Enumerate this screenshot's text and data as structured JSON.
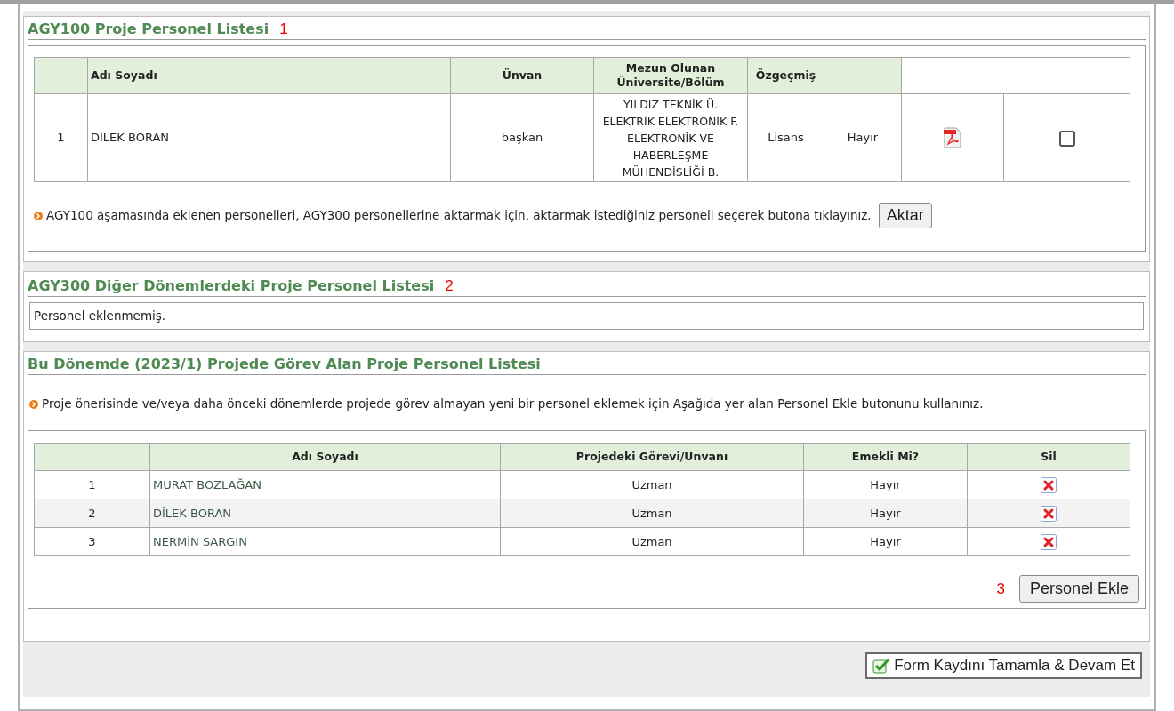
{
  "section1": {
    "title": "AGY100 Proje Personel Listesi",
    "marker": "1",
    "columns": [
      "",
      "Adı Soyadı",
      "Ünvan",
      "Mezun Olunan Üniversite/Bölüm",
      "Özgeçmiş",
      "",
      ""
    ],
    "rows": [
      {
        "no": "1",
        "name": "DİLEK BORAN",
        "title": "başkan",
        "university": "YILDIZ TEKNİK Ü. ELEKTRİK ELEKTRONİK F. ELEKTRONİK VE HABERLEŞME MÜHENDİSLİĞİ B.",
        "degree": "Lisans",
        "retired": "Hayır",
        "checked": false
      }
    ],
    "note": "AGY100 aşamasında eklenen personelleri, AGY300 personellerine aktarmak için, aktarmak istediğiniz personeli seçerek butona tıklayınız.",
    "button": "Aktar"
  },
  "section2": {
    "title": "AGY300 Diğer Dönemlerdeki Proje Personel Listesi",
    "marker": "2",
    "empty_text": "Personel eklenmemiş."
  },
  "section3": {
    "title": "Bu Dönemde (2023/1) Projede Görev Alan Proje Personel Listesi",
    "note": "Proje önerisinde ve/veya daha önceki dönemlerde projede görev almayan yeni bir personel eklemek için Aşağıda yer alan Personel Ekle butonunu kullanınız.",
    "columns": [
      "",
      "Adı Soyadı",
      "Projedeki Görevi/Unvanı",
      "Emekli Mi?",
      "Sil"
    ],
    "rows": [
      {
        "no": "1",
        "name": "MURAT BOZLAĞAN",
        "role": "Uzman",
        "retired": "Hayır"
      },
      {
        "no": "2",
        "name": "DİLEK BORAN",
        "role": "Uzman",
        "retired": "Hayır"
      },
      {
        "no": "3",
        "name": "NERMİN SARGIN",
        "role": "Uzman",
        "retired": "Hayır"
      }
    ],
    "marker": "3",
    "button": "Personel Ekle"
  },
  "footer_button": "Form Kaydını Tamamla & Devam Et"
}
